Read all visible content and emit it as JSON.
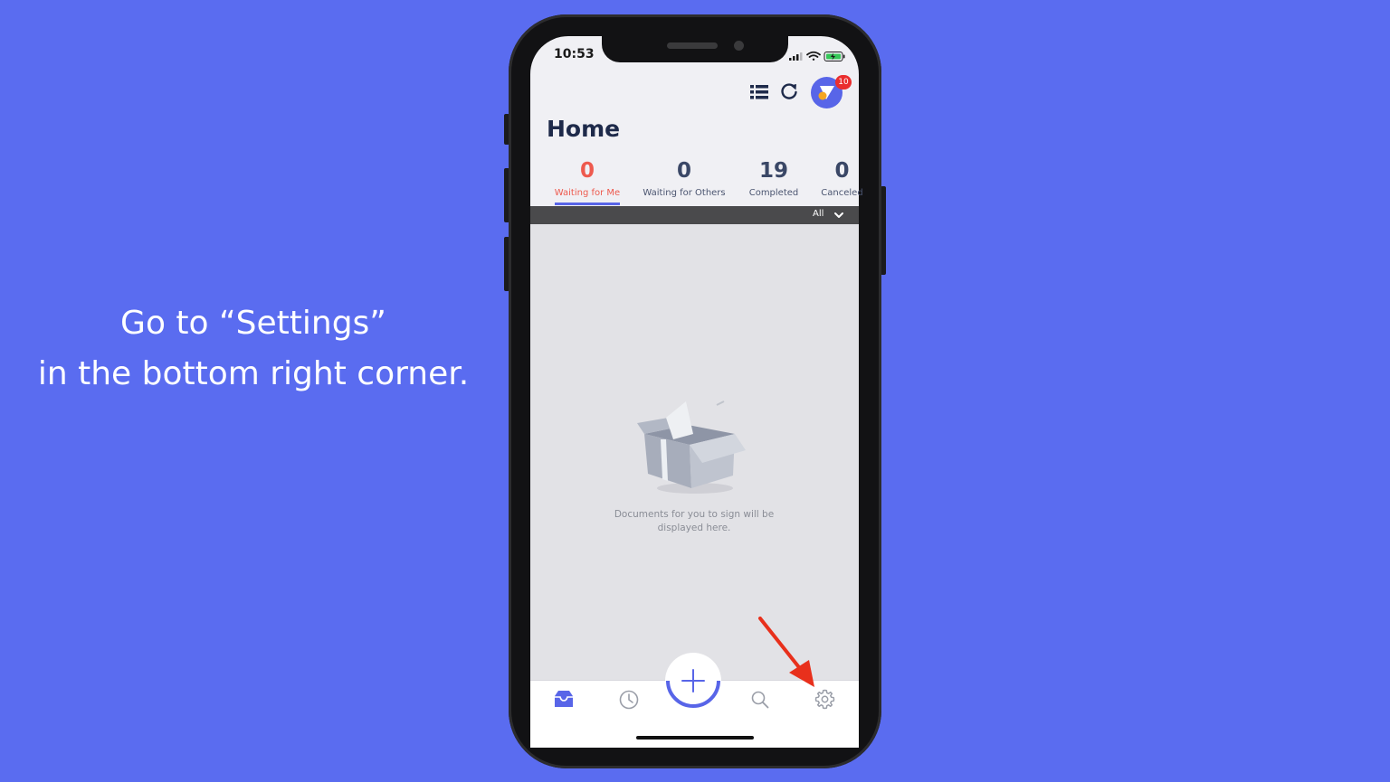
{
  "instruction": {
    "line1": "Go to “Settings”",
    "line2": "in the bottom right corner."
  },
  "status_bar": {
    "time": "10:53"
  },
  "header": {
    "notification_count": "10",
    "icons": [
      "list-icon",
      "refresh-icon",
      "avatar"
    ]
  },
  "page": {
    "title": "Home"
  },
  "stats": [
    {
      "count": "0",
      "label": "Waiting for Me",
      "active": true
    },
    {
      "count": "0",
      "label": "Waiting for Others",
      "active": false
    },
    {
      "count": "19",
      "label": "Completed",
      "active": false
    },
    {
      "count": "0",
      "label": "Canceled",
      "active": false
    }
  ],
  "filter": {
    "label": "All"
  },
  "empty_state": {
    "line1": "Documents for you to sign will be",
    "line2": "displayed here."
  },
  "bottom_nav": {
    "items": [
      "inbox-icon",
      "clock-icon",
      "add-icon",
      "search-icon",
      "gear-icon"
    ]
  },
  "colors": {
    "background": "#5a6cf0",
    "accent": "#5865e8",
    "active_stat": "#ee5a4e",
    "arrow": "#e8301c"
  }
}
